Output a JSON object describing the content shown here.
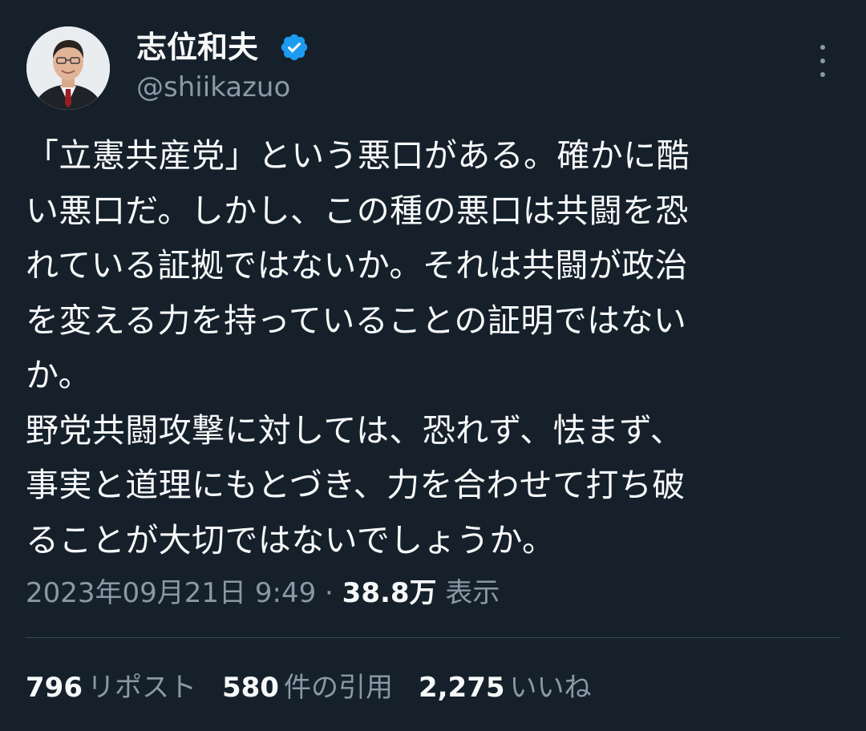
{
  "author": {
    "display_name": "志位和夫",
    "handle": "@shiikazuo",
    "verified": true,
    "avatar_icon": "profile-photo"
  },
  "tweet": {
    "lines": [
      "「立憲共産党」という悪口がある。確かに酷",
      "い悪口だ。しかし、この種の悪口は共闘を恐",
      "れている証拠ではないか。それは共闘が政治",
      "を変える力を持っていることの証明ではない",
      "か。",
      "野党共闘攻撃に対しては、恐れず、怯まず、",
      "事実と道理にもとづき、力を合わせて打ち破",
      "ることが大切ではないでしょうか。"
    ]
  },
  "meta": {
    "timestamp": "2023年09月21日 9:49",
    "separator": " · ",
    "views_count": "38.8万",
    "views_label": "表示"
  },
  "stats": {
    "reposts": {
      "count": "796",
      "label": "リポスト"
    },
    "quotes": {
      "count": "580",
      "label": "件の引用"
    },
    "likes": {
      "count": "2,275",
      "label": "いいね"
    }
  },
  "colors": {
    "background": "#15202b",
    "text_primary": "#f7f9f9",
    "text_secondary": "#8b98a5",
    "verified_badge": "#1d9bf0",
    "divider": "#38444d"
  }
}
